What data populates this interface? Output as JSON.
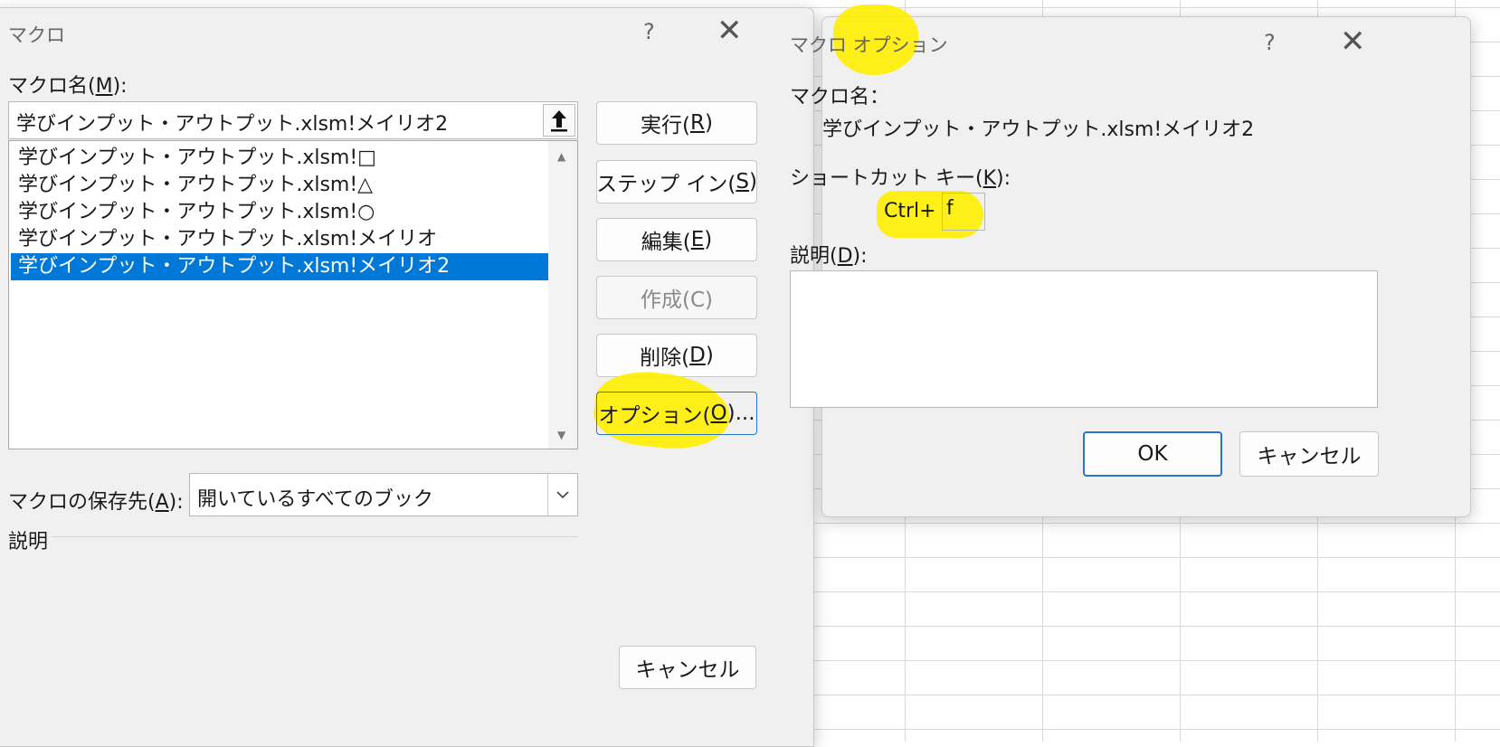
{
  "macro_dialog": {
    "title": "マクロ",
    "help": "?",
    "close": "✕",
    "macro_name_label": "マクロ名(",
    "macro_name_key": "M",
    "macro_name_suffix": "):",
    "macro_name_value": "学びインプット・アウトプット.xlsm!メイリオ2",
    "macro_list": [
      "学びインプット・アウトプット.xlsm!□",
      "学びインプット・アウトプット.xlsm!△",
      "学びインプット・アウトプット.xlsm!○",
      "学びインプット・アウトプット.xlsm!メイリオ",
      "学びインプット・アウトプット.xlsm!メイリオ2"
    ],
    "selected_index": 4,
    "buttons": {
      "run": {
        "text": "実行(",
        "key": "R",
        "suffix": ")"
      },
      "step_in": {
        "text": "ステップ イン(",
        "key": "S",
        "suffix": ")"
      },
      "edit": {
        "text": "編集(",
        "key": "E",
        "suffix": ")"
      },
      "create": "作成(C)",
      "delete": {
        "text": "削除(",
        "key": "D",
        "suffix": ")"
      },
      "options": {
        "text": "オプション(",
        "key": "O",
        "suffix": ")..."
      },
      "cancel": "キャンセル"
    },
    "store_label": "マクロの保存先(",
    "store_key": "A",
    "store_suffix": "):",
    "store_value": "開いているすべてのブック",
    "description_label": "説明"
  },
  "options_dialog": {
    "title": "マクロ オプション",
    "help": "?",
    "close": "✕",
    "macro_name_label": "マクロ名：",
    "macro_name_value": "学びインプット・アウトプット.xlsm!メイリオ2",
    "shortcut_label": "ショートカット キー(",
    "shortcut_key": "K",
    "shortcut_suffix": "):",
    "ctrl_label": "Ctrl+",
    "shortcut_value": "f",
    "description_label": "説明(",
    "description_key": "D",
    "description_suffix": "):",
    "description_value": "",
    "ok_label": "OK",
    "cancel_label": "キャンセル"
  },
  "colors": {
    "highlight": "#ffee00",
    "selection": "#0078d7",
    "default_button_border": "#2a76c6"
  }
}
